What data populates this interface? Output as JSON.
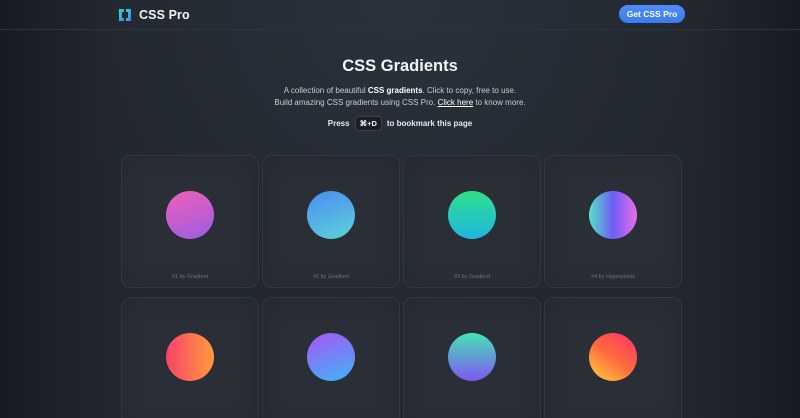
{
  "header": {
    "logo_text": "CSS Pro",
    "cta_label": "Get CSS Pro",
    "accent": "#3c7cf0"
  },
  "hero": {
    "title": "CSS Gradients",
    "desc1_a": "A collection of beautiful ",
    "desc1_b": "CSS gradients",
    "desc1_c": ". Click to copy, free to use.",
    "desc2_a": "Build amazing CSS gradients using CSS Pro. ",
    "desc2_link": "Click here",
    "desc2_b": " to know more.",
    "bookmark_a": "Press",
    "bookmark_key": "⌘+D",
    "bookmark_b": "to bookmark this page"
  },
  "gradients": [
    {
      "caption": "#1 by Gradient",
      "colors": [
        "#f05fb4",
        "#9b5de5"
      ],
      "angle": "160deg"
    },
    {
      "caption": "#2 by Gradient",
      "colors": [
        "#4a8cf0",
        "#5ed3d8"
      ],
      "angle": "160deg"
    },
    {
      "caption": "#3 by Gradient",
      "colors": [
        "#31e08b",
        "#1bb7e0"
      ],
      "angle": "180deg"
    },
    {
      "caption": "#4 by Hyperpixels",
      "colors": [
        "#55e2c6",
        "#6f5cf6",
        "#e96ee6"
      ],
      "angle": "90deg"
    },
    {
      "caption": "",
      "colors": [
        "#f9436a",
        "#ff9a3c"
      ],
      "angle": "90deg"
    },
    {
      "caption": "",
      "colors": [
        "#a855f7",
        "#3fb4f5"
      ],
      "angle": "160deg"
    },
    {
      "caption": "",
      "colors": [
        "#46e3b7",
        "#7f56f0"
      ],
      "angle": "180deg"
    },
    {
      "caption": "",
      "colors": [
        "#ffd23f",
        "#ff6a3d",
        "#ff2f6d"
      ],
      "angle": "35deg"
    }
  ]
}
